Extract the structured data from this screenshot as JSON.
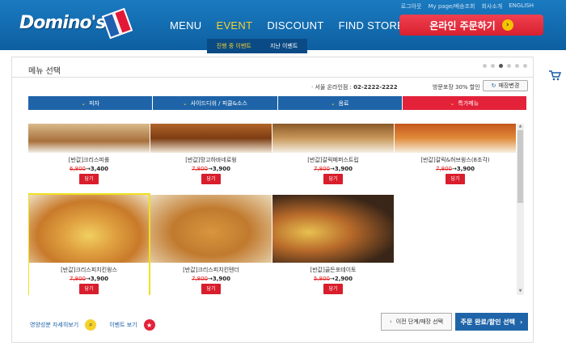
{
  "header": {
    "logo_text": "Domino's",
    "nav": [
      "MENU",
      "EVENT",
      "DISCOUNT",
      "FIND STORE"
    ],
    "subnav": [
      "진행 중 이벤트",
      "지난 이벤트"
    ],
    "toplinks": [
      "로그아웃",
      "My page/배송조회",
      "회사소개",
      "ENGLISH"
    ],
    "order_button": "온라인 주문하기"
  },
  "panel": {
    "title": "메뉴 선택",
    "store_label": "서울 온라인점 :",
    "store_phone": "02-2222-2222",
    "discount_text": "방문포장 30% 할인",
    "store_change_button": "매장변경"
  },
  "tabs": [
    "피자",
    "사이드디쉬 / 피클&소스",
    "음료",
    "특가메뉴"
  ],
  "items": [
    {
      "name": "[반값]크리스피롤",
      "old_price": "6,800",
      "new_price": "3,400",
      "add": "담기"
    },
    {
      "name": "[반값]망고하바네로윙",
      "old_price": "7,800",
      "new_price": "3,900",
      "add": "담기"
    },
    {
      "name": "[반값]갈릭페퍼스트립",
      "old_price": "7,800",
      "new_price": "3,900",
      "add": "담기"
    },
    {
      "name": "[반값]갈릭&허브윙스(8조각)",
      "old_price": "7,800",
      "new_price": "3,900",
      "add": "담기"
    },
    {
      "name": "[반값]크리스피치킨윙스",
      "old_price": "7,800",
      "new_price": "3,900",
      "add": "담기"
    },
    {
      "name": "[반값]크리스피치킨텐더",
      "old_price": "7,800",
      "new_price": "3,900",
      "add": "담기"
    },
    {
      "name": "[반값]골든포테이토",
      "old_price": "5,800",
      "new_price": "2,900",
      "add": "담기"
    }
  ],
  "footer": {
    "nutrition_link": "영양성분 자세히보기",
    "event_link": "이벤트 보기",
    "prev_button": "이전 단계/매장 선택",
    "next_button": "주문 완료/할인 선택"
  },
  "colors": {
    "header_blue": "#1a7ac0",
    "tab_blue": "#1f64a8",
    "tab_active_red": "#e3223a",
    "accent_yellow": "#f5d22c",
    "add_button_red": "#d81e2c"
  }
}
